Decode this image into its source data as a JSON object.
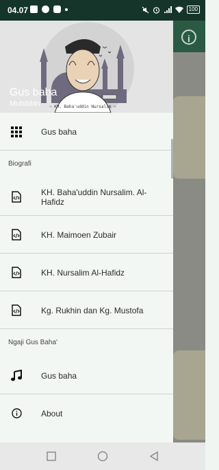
{
  "status_bar": {
    "time": "04.07",
    "battery": "100",
    "left_icons": [
      "mail-icon",
      "whatsapp-icon",
      "youtube-icon",
      "dot-icon"
    ],
    "right_icons": [
      "mute-icon",
      "alarm-icon",
      "signal-icon",
      "wifi-icon",
      "battery-icon"
    ]
  },
  "drawer": {
    "header": {
      "title": "Gus baha",
      "subtitle": "Muhibbin",
      "caption": "~ KH. Baha'uddin Nursalim ~"
    },
    "top_item": {
      "label": "Gus baha",
      "icon": "grid-icon"
    },
    "sections": [
      {
        "title": "Biografi",
        "items": [
          {
            "label": "KH. Baha'uddin Nursalim. Al-Hafidz",
            "icon": "code-file-icon"
          },
          {
            "label": "KH. Maimoen Zubair",
            "icon": "code-file-icon"
          },
          {
            "label": "KH. Nursalim Al-Hafidz",
            "icon": "code-file-icon"
          },
          {
            "label": "Kg. Rukhin dan Kg. Mustofa",
            "icon": "code-file-icon"
          }
        ]
      },
      {
        "title": "Ngaji Gus Baha'",
        "items": [
          {
            "label": "Gus baha",
            "icon": "music-note-icon"
          }
        ]
      }
    ],
    "about": {
      "label": "About",
      "icon": "info-icon"
    }
  },
  "colors": {
    "status_bar": "#16352a",
    "app_bar": "#2a5a44",
    "drawer_bg": "#f3f7f4",
    "scrim": "#8b8b85"
  },
  "nav_bar": {
    "buttons": [
      "recents-button",
      "home-button",
      "back-button"
    ]
  }
}
